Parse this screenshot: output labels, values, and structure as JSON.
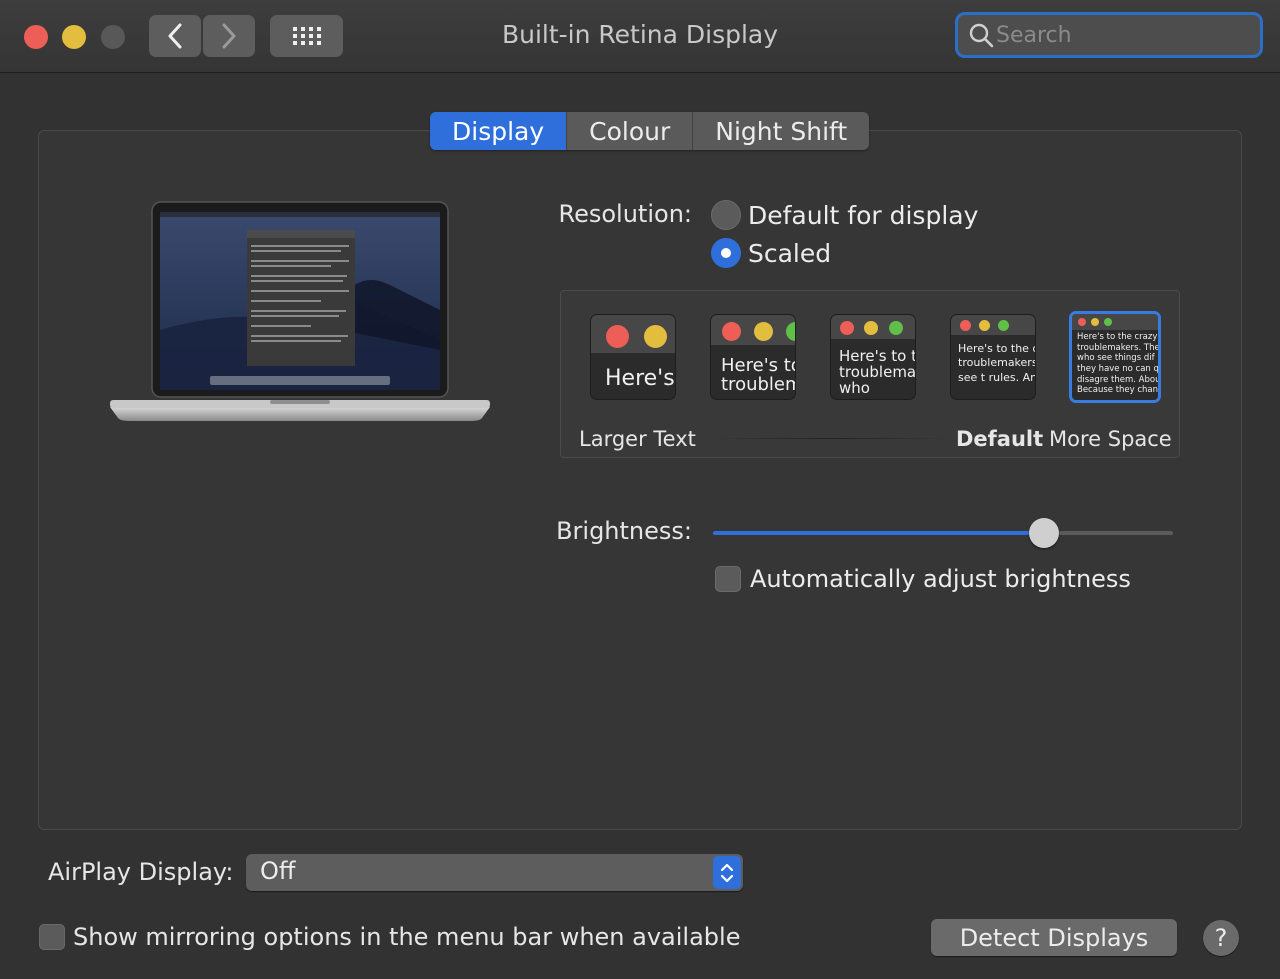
{
  "window": {
    "title": "Built-in Retina Display"
  },
  "search": {
    "placeholder": "Search",
    "value": ""
  },
  "tabs": [
    {
      "label": "Display",
      "active": true
    },
    {
      "label": "Colour",
      "active": false
    },
    {
      "label": "Night Shift",
      "active": false
    }
  ],
  "resolution": {
    "label": "Resolution:",
    "options": [
      {
        "label": "Default for display",
        "selected": false
      },
      {
        "label": "Scaled",
        "selected": true
      }
    ]
  },
  "scaling": {
    "thumbnails": [
      {
        "text": "Here's",
        "selected": false
      },
      {
        "text": "Here's to troublem",
        "selected": false
      },
      {
        "text": "Here's to t troublema ones who",
        "selected": false
      },
      {
        "text": "Here's to the cr troublemakers. ones who see t rules. And they",
        "selected": false
      },
      {
        "text": "Here's to the crazy one troublemakers. The rou ones who see things dif rules. And they have no can quote them, disagre them. About the only th Because they change th",
        "selected": true
      }
    ],
    "labels": {
      "larger": "Larger Text",
      "default": "Default",
      "more": "More Space"
    }
  },
  "brightness": {
    "label": "Brightness:",
    "level": 0.72,
    "auto_label": "Automatically adjust brightness",
    "auto_checked": false
  },
  "airplay": {
    "label": "AirPlay Display:",
    "value": "Off"
  },
  "mirroring": {
    "label": "Show mirroring options in the menu bar when available",
    "checked": false
  },
  "detect_button": "Detect Displays",
  "help": "?",
  "colors": {
    "accent": "#2f6fdc",
    "close": "#ed5f56",
    "minimize": "#e3bd3e"
  }
}
